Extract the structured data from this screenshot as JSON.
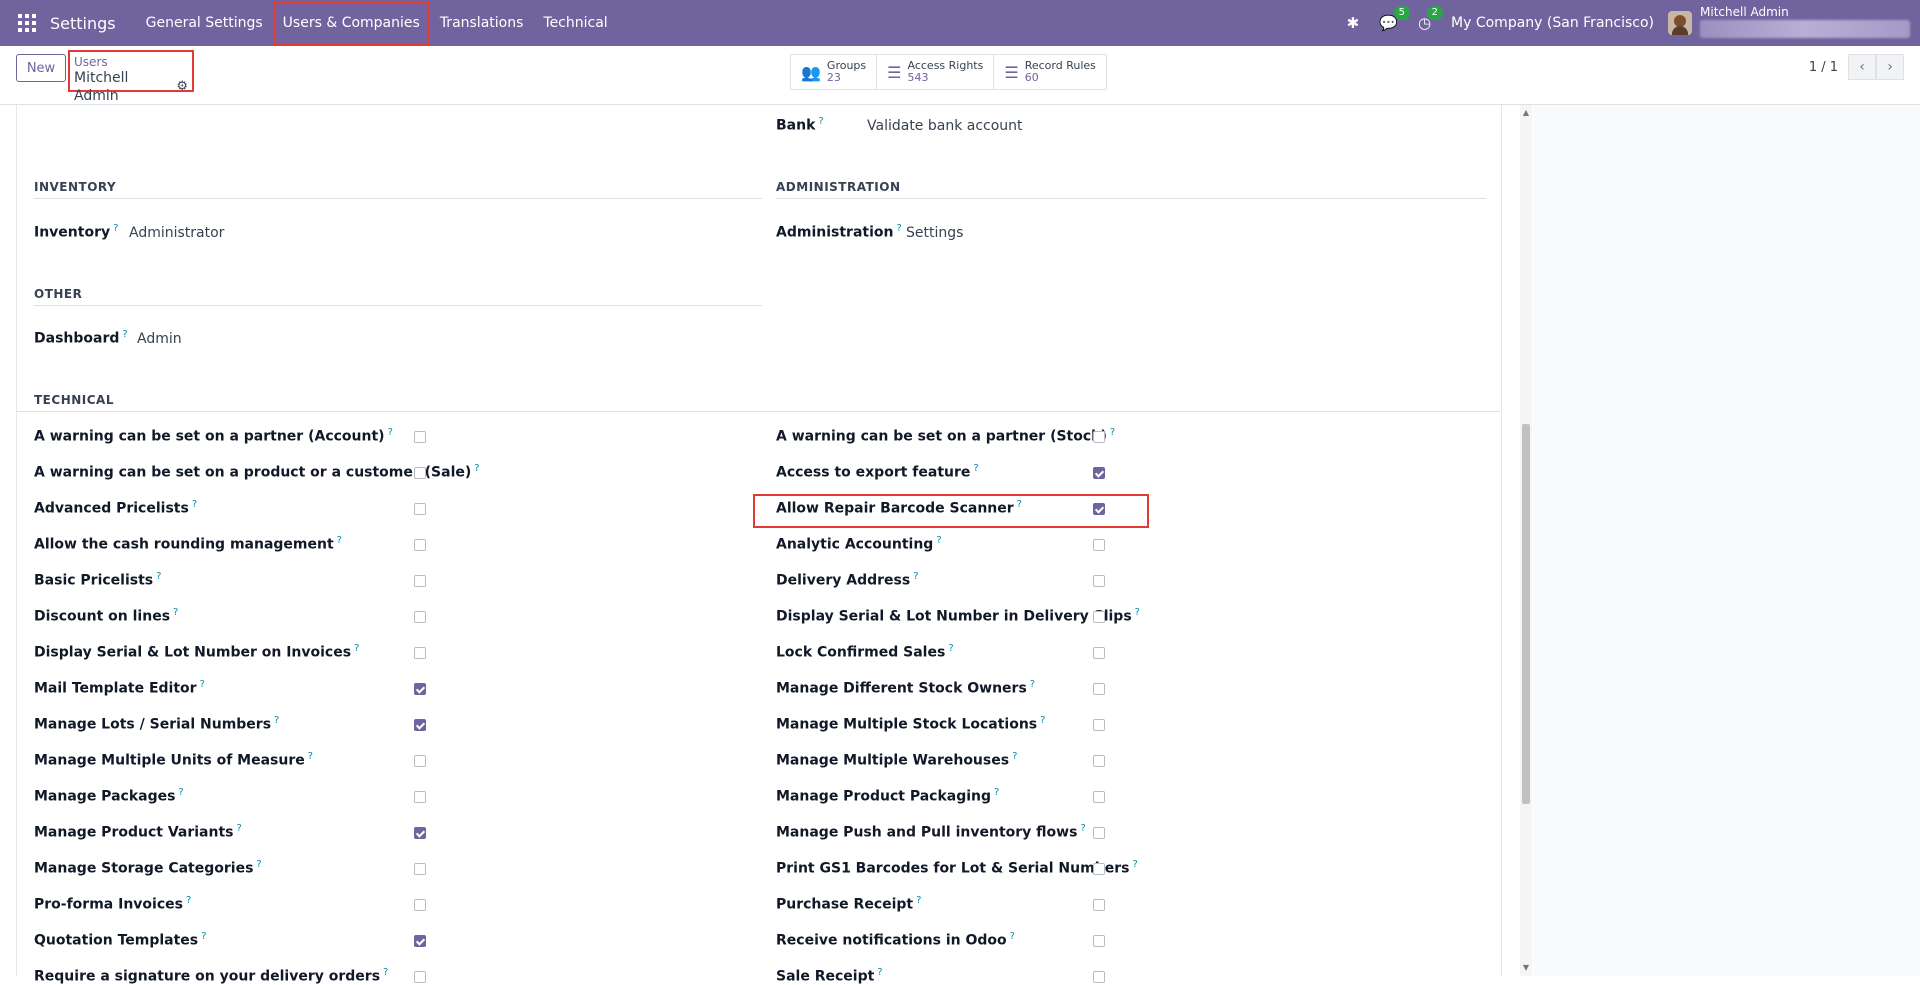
{
  "navbar": {
    "brand": "Settings",
    "menus": [
      "General Settings",
      "Users & Companies",
      "Translations",
      "Technical"
    ],
    "chat_badge": "5",
    "activity_badge": "2",
    "company": "My Company (San Francisco)",
    "user": "Mitchell Admin"
  },
  "control_panel": {
    "new_label": "New",
    "breadcrumb_parent": "Users",
    "breadcrumb_current": "Mitchell Admin",
    "stats": [
      {
        "label": "Groups",
        "value": "23"
      },
      {
        "label": "Access Rights",
        "value": "543"
      },
      {
        "label": "Record Rules",
        "value": "60"
      }
    ],
    "pager": "1 / 1"
  },
  "form": {
    "bank_label": "Bank",
    "bank_value": "Validate bank account",
    "inventory_title": "INVENTORY",
    "inventory_label": "Inventory",
    "inventory_value": "Administrator",
    "administration_title": "ADMINISTRATION",
    "administration_label": "Administration",
    "administration_value": "Settings",
    "other_title": "OTHER",
    "dashboard_label": "Dashboard",
    "dashboard_value": "Admin",
    "technical_title": "TECHNICAL"
  },
  "technical_left": [
    {
      "label": "A warning can be set on a partner (Account)",
      "checked": false
    },
    {
      "label": "A warning can be set on a product or a customer (Sale)",
      "checked": false
    },
    {
      "label": "Advanced Pricelists",
      "checked": false
    },
    {
      "label": "Allow the cash rounding management",
      "checked": false
    },
    {
      "label": "Basic Pricelists",
      "checked": false
    },
    {
      "label": "Discount on lines",
      "checked": false
    },
    {
      "label": "Display Serial & Lot Number on Invoices",
      "checked": false
    },
    {
      "label": "Mail Template Editor",
      "checked": true
    },
    {
      "label": "Manage Lots / Serial Numbers",
      "checked": true
    },
    {
      "label": "Manage Multiple Units of Measure",
      "checked": false
    },
    {
      "label": "Manage Packages",
      "checked": false
    },
    {
      "label": "Manage Product Variants",
      "checked": true
    },
    {
      "label": "Manage Storage Categories",
      "checked": false
    },
    {
      "label": "Pro-forma Invoices",
      "checked": false
    },
    {
      "label": "Quotation Templates",
      "checked": true
    },
    {
      "label": "Require a signature on your delivery orders",
      "checked": false
    }
  ],
  "technical_right": [
    {
      "label": "A warning can be set on a partner (Stock)",
      "checked": false
    },
    {
      "label": "Access to export feature",
      "checked": true
    },
    {
      "label": "Allow Repair Barcode Scanner",
      "checked": true
    },
    {
      "label": "Analytic Accounting",
      "checked": false
    },
    {
      "label": "Delivery Address",
      "checked": false
    },
    {
      "label": "Display Serial & Lot Number in Delivery Slips",
      "checked": false
    },
    {
      "label": "Lock Confirmed Sales",
      "checked": false
    },
    {
      "label": "Manage Different Stock Owners",
      "checked": false
    },
    {
      "label": "Manage Multiple Stock Locations",
      "checked": false
    },
    {
      "label": "Manage Multiple Warehouses",
      "checked": false
    },
    {
      "label": "Manage Product Packaging",
      "checked": false
    },
    {
      "label": "Manage Push and Pull inventory flows",
      "checked": false
    },
    {
      "label": "Print GS1 Barcodes for Lot & Serial Numbers",
      "checked": false
    },
    {
      "label": "Purchase Receipt",
      "checked": false
    },
    {
      "label": "Receive notifications in Odoo",
      "checked": false
    },
    {
      "label": "Sale Receipt",
      "checked": false
    }
  ],
  "colors": {
    "navbar": "#71639e",
    "accent": "#71639e",
    "highlight": "#e53935"
  }
}
